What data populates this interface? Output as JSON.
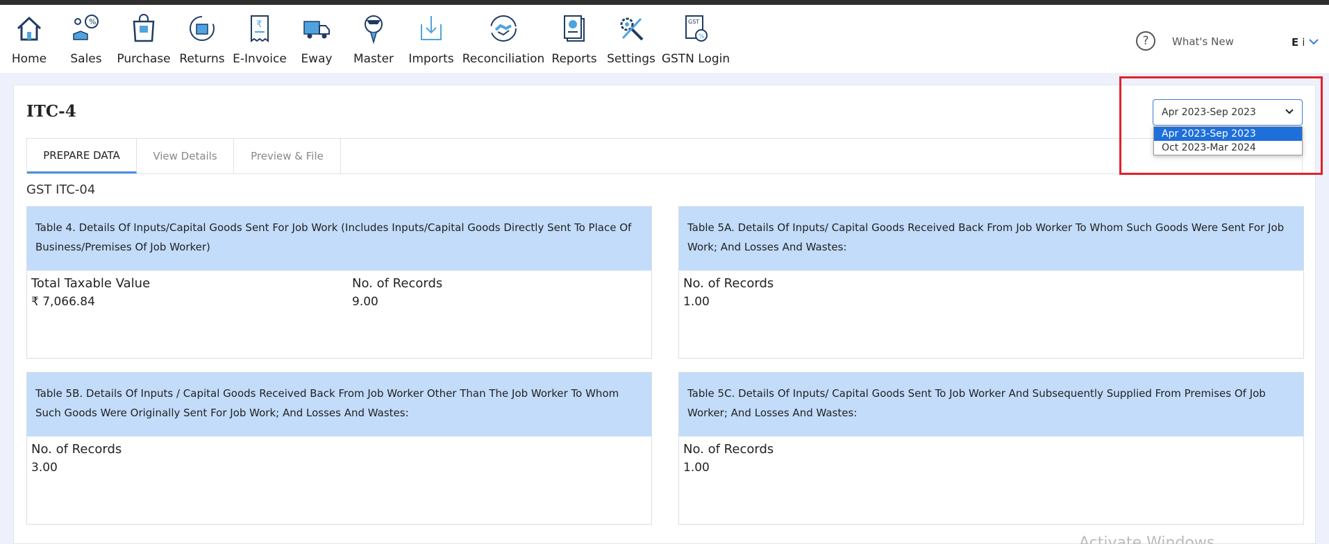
{
  "nav": {
    "items": [
      {
        "label": "Home",
        "icon": "home-icon"
      },
      {
        "label": "Sales",
        "icon": "sales-icon"
      },
      {
        "label": "Purchase",
        "icon": "purchase-icon"
      },
      {
        "label": "Returns",
        "icon": "returns-icon"
      },
      {
        "label": "E-Invoice",
        "icon": "e-invoice-icon"
      },
      {
        "label": "Eway",
        "icon": "eway-truck-icon"
      },
      {
        "label": "Master",
        "icon": "master-icon"
      },
      {
        "label": "Imports",
        "icon": "imports-icon"
      },
      {
        "label": "Reconciliation",
        "icon": "reconciliation-icon"
      },
      {
        "label": "Reports",
        "icon": "reports-icon"
      },
      {
        "label": "Settings",
        "icon": "settings-icon"
      },
      {
        "label": "GSTN Login",
        "icon": "gstn-login-icon"
      }
    ],
    "help_glyph": "?",
    "whats_new": "What's New",
    "user_name": "E in"
  },
  "page": {
    "title": "ITC-4",
    "tabs": [
      {
        "label": "PREPARE DATA",
        "active": true
      },
      {
        "label": "View Details",
        "active": false
      },
      {
        "label": "Preview & File",
        "active": false
      }
    ],
    "section_title": "GST ITC-04"
  },
  "period": {
    "selected": "Apr 2023-Sep 2023",
    "options": [
      "Apr 2023-Sep 2023",
      "Oct 2023-Mar 2024"
    ]
  },
  "cards": [
    {
      "title": "Table 4. Details Of Inputs/Capital Goods Sent For Job Work (Includes Inputs/Capital Goods Directly Sent To Place Of Business/Premises Of Job Worker)",
      "metrics": [
        {
          "label": "Total Taxable Value",
          "value": "₹ 7,066.84"
        },
        {
          "label": "No. of Records",
          "value": "9.00"
        }
      ]
    },
    {
      "title": "Table 5A. Details Of Inputs/ Capital Goods Received Back From Job Worker To Whom Such Goods Were Sent For Job Work; And Losses And Wastes:",
      "metrics": [
        {
          "label": "No. of Records",
          "value": "1.00"
        }
      ]
    },
    {
      "title": "Table 5B. Details Of Inputs / Capital Goods Received Back From Job Worker Other Than The Job Worker To Whom Such Goods Were Originally Sent For Job Work; And Losses And Wastes:",
      "metrics": [
        {
          "label": "No. of Records",
          "value": "3.00"
        }
      ]
    },
    {
      "title": "Table 5C. Details Of Inputs/ Capital Goods Sent To Job Worker And Subsequently Supplied From Premises Of Job Worker; And Losses And Wastes:",
      "metrics": [
        {
          "label": "No. of Records",
          "value": "1.00"
        }
      ]
    }
  ],
  "watermark": "Activate Windows",
  "colors": {
    "accent": "#1e6fd9",
    "card_header": "#c2dcfa",
    "highlight": "#e3202a"
  }
}
